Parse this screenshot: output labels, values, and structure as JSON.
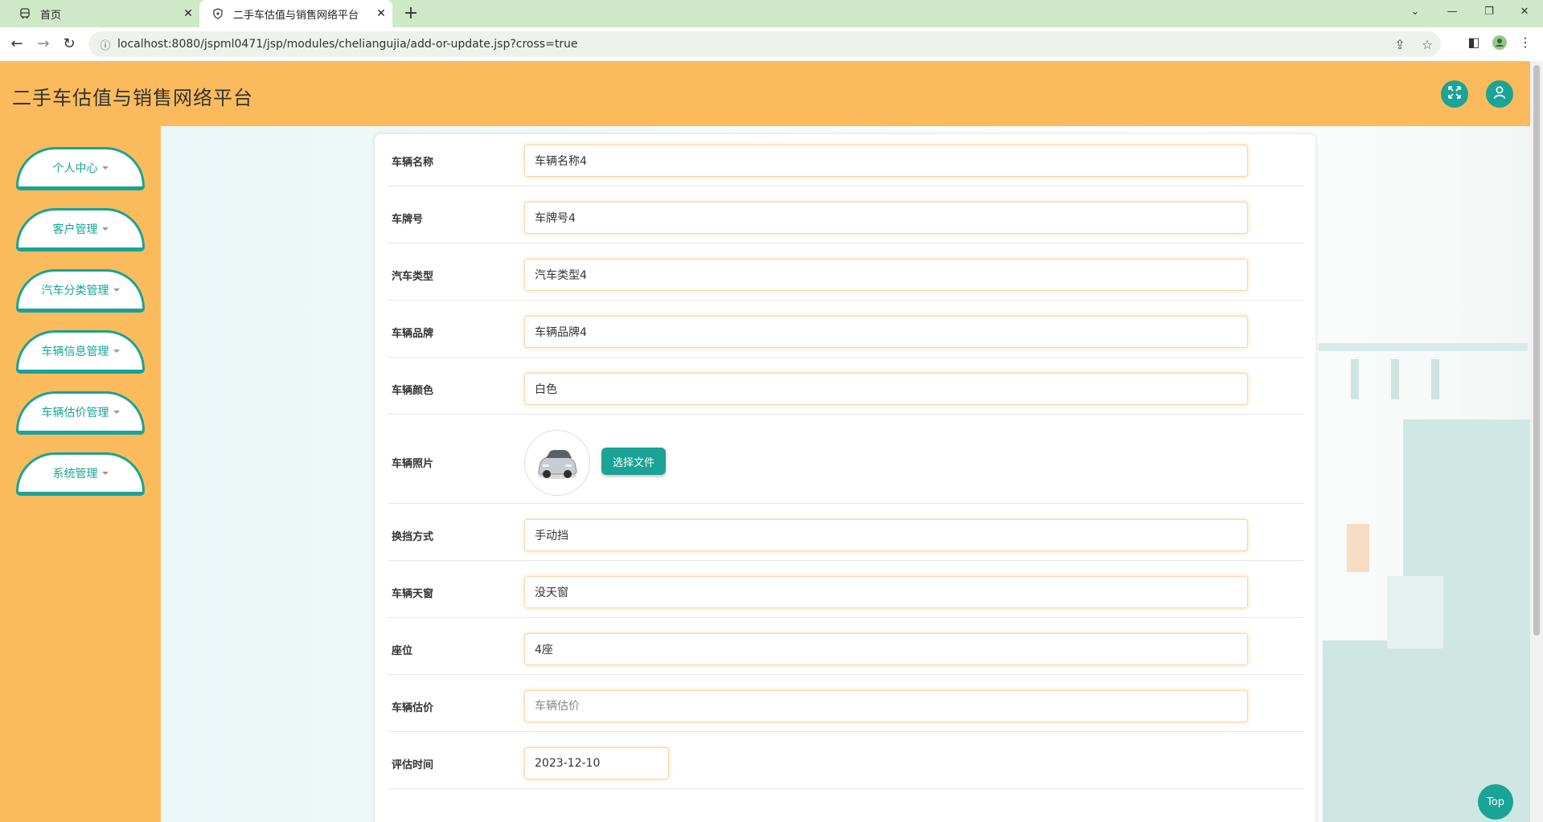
{
  "browser": {
    "tabs": [
      {
        "title": "首页",
        "icon": "bus-icon"
      },
      {
        "title": "二手车估值与销售网络平台",
        "icon": "shield-icon"
      }
    ],
    "url": "localhost:8080/jspml0471/jsp/modules/cheliangujia/add-or-update.jsp?cross=true"
  },
  "app": {
    "title": "二手车估值与销售网络平台",
    "accent_color": "#1aa396",
    "header_color": "#fbbb5c"
  },
  "sidebar": {
    "items": [
      {
        "label": "个人中心"
      },
      {
        "label": "客户管理"
      },
      {
        "label": "汽车分类管理"
      },
      {
        "label": "车辆信息管理"
      },
      {
        "label": "车辆估价管理"
      },
      {
        "label": "系统管理"
      }
    ]
  },
  "form": {
    "fields": [
      {
        "label": "车辆名称",
        "value": "车辆名称4"
      },
      {
        "label": "车牌号",
        "value": "车牌号4"
      },
      {
        "label": "汽车类型",
        "value": "汽车类型4"
      },
      {
        "label": "车辆品牌",
        "value": "车辆品牌4"
      },
      {
        "label": "车辆颜色",
        "value": "白色"
      },
      {
        "label": "车辆照片",
        "button": "选择文件"
      },
      {
        "label": "换挡方式",
        "value": "手动挡"
      },
      {
        "label": "车辆天窗",
        "value": "没天窗"
      },
      {
        "label": "座位",
        "value": "4座"
      },
      {
        "label": "车辆估价",
        "value": "",
        "placeholder": "车辆估价"
      },
      {
        "label": "评估时间",
        "value": "2023-12-10"
      }
    ]
  },
  "top_button": {
    "label": "Top"
  }
}
